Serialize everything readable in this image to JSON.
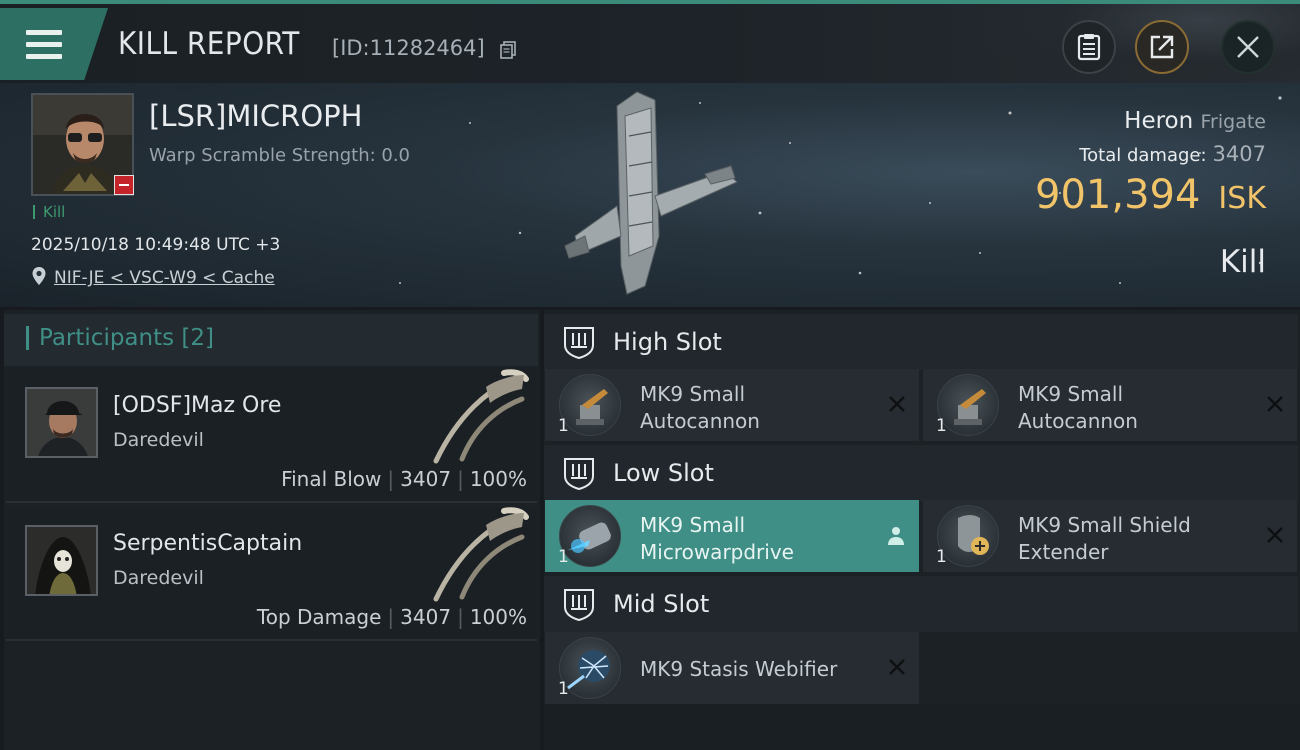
{
  "header": {
    "title": "KILL REPORT",
    "report_id": "[ID:11282464]"
  },
  "victim": {
    "name": "[LSR]MICROPH",
    "warp_scramble": "Warp Scramble Strength: 0.0",
    "kill_tag": "Kill",
    "datetime": "2025/10/18 10:49:48 UTC +3",
    "location": "NIF-JE < VSC-W9 < Cache",
    "ship_name": "Heron",
    "ship_class": "Frigate",
    "total_damage_label": "Total damage:",
    "total_damage_value": "3407",
    "isk_value": "901,394",
    "isk_unit": "ISK",
    "kill_type": "Kill"
  },
  "participants": {
    "label": "Participants",
    "count": "[2]",
    "items": [
      {
        "name": "[ODSF]Maz Ore",
        "ship": "Daredevil",
        "role": "Final Blow",
        "damage": "3407",
        "percent": "100%"
      },
      {
        "name": "SerpentisCaptain",
        "ship": "Daredevil",
        "role": "Top Damage",
        "damage": "3407",
        "percent": "100%"
      }
    ]
  },
  "slots": {
    "high": {
      "label": "High Slot",
      "modules": [
        {
          "name_line1": "MK9 Small",
          "name_line2": "Autocannon",
          "qty": "1"
        },
        {
          "name_line1": "MK9 Small",
          "name_line2": "Autocannon",
          "qty": "1"
        }
      ]
    },
    "low": {
      "label": "Low Slot",
      "modules": [
        {
          "name_line1": "MK9 Small",
          "name_line2": "Microwarpdrive",
          "qty": "1"
        },
        {
          "name_line1": "MK9 Small Shield",
          "name_line2": "Extender",
          "qty": "1"
        }
      ]
    },
    "mid": {
      "label": "Mid Slot",
      "modules": [
        {
          "name_line1": "MK9 Stasis Webifier",
          "name_line2": "",
          "qty": "1"
        }
      ]
    }
  },
  "colors": {
    "accent": "#3f8f86",
    "isk": "#f1c46a",
    "kill_green": "#3d9a6f",
    "badge_red": "#c4242a"
  }
}
